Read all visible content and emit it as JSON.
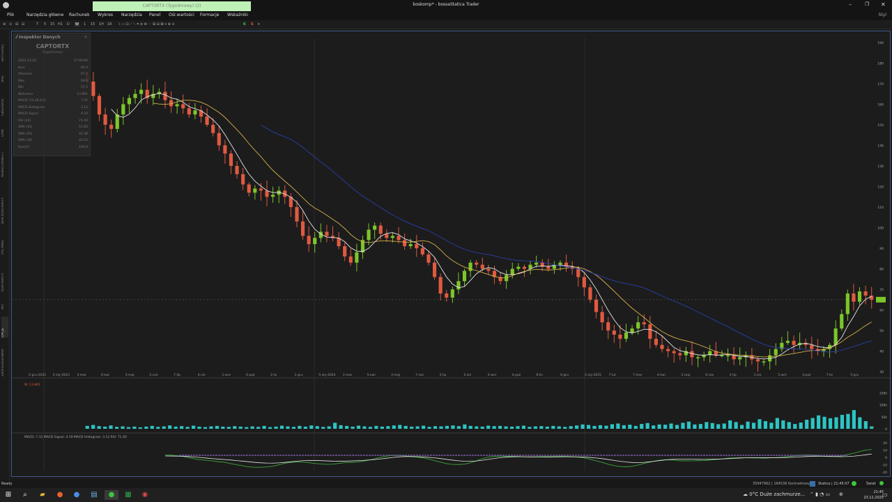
{
  "window": {
    "title": "boskomp* - bossaStatica Trader",
    "tab_label": "CAPTORTX (Tygodniowy) (2)",
    "min_icon": "minimize-icon",
    "max_icon": "maximize-icon",
    "close_icon": "close-icon"
  },
  "menu": [
    "Plik",
    "Narzędzia główne",
    "Rachunek",
    "Wykres",
    "Narzędzia",
    "Panel",
    "Ośr.wartości",
    "Formacje",
    "Wskaźniki"
  ],
  "menu_right": "Styl",
  "toolbar": {
    "intervals": [
      "T",
      "5",
      "15",
      "H1",
      "D",
      "W",
      "1",
      "15",
      "1H",
      "1R"
    ],
    "letters": [
      "K",
      "S"
    ]
  },
  "left_rail": [
    "BATTERIES",
    "BHS",
    "OBSERVOS",
    "OPW",
    "NEWSCONNECT",
    "BHR KONTRAKTY",
    "TYG MWS",
    "KONTRAKTY",
    "AKT",
    "OPCJE",
    "ZAINTERESOWANIA"
  ],
  "inspector": {
    "title": "Inspektor Danych",
    "symbol": "CAPTORTX",
    "period": "(Tygodniowy)",
    "rows": [
      {
        "k": "2025-12-22",
        "v": "17:40:00"
      },
      {
        "k": "Kurs",
        "v": "65.0"
      },
      {
        "k": "Otwarcie",
        "v": "67.2"
      },
      {
        "k": "Max",
        "v": "69.0"
      },
      {
        "k": "Min",
        "v": "57.2"
      },
      {
        "k": "Wolumen",
        "v": "13 861"
      },
      {
        "k": "MACD (12,26,9,2)",
        "v": "7.31"
      },
      {
        "k": "MACD Histogram",
        "v": "3.12"
      },
      {
        "k": "MACD Signal",
        "v": "4.19"
      },
      {
        "k": "RSI (14)",
        "v": "71.40"
      },
      {
        "k": "SMA (15)",
        "v": "51.83"
      },
      {
        "k": "SMA (45)",
        "v": "42.38"
      },
      {
        "k": "SMA (30)",
        "v": "44.53"
      },
      {
        "k": "Kurs(Y)",
        "v": "100.0"
      }
    ]
  },
  "price_axis": [
    "190",
    "180",
    "170",
    "160",
    "150",
    "140",
    "130",
    "120",
    "110",
    "100",
    "90",
    "80",
    "70",
    "60",
    "50",
    "40",
    "30"
  ],
  "date_axis": [
    "2-gru-2022",
    "5-sty-2023",
    "3-mar",
    "6-kwi",
    "5-maj",
    "2-cze",
    "7-lip",
    "4-sie",
    "1-wrz",
    "6-paź",
    "3-lis",
    "1-gru",
    "5-sty-2024",
    "1-mar",
    "5-kwi",
    "2-maj",
    "7-cze",
    "5-lip",
    "2-sie",
    "6-wrz",
    "4-paź",
    "8-lis",
    "6-gru",
    "3-sty-2025",
    "7-lut",
    "7-mar",
    "4-kwi",
    "2-maj",
    "6-cze",
    "4-lip",
    "1-sie",
    "5-wrz",
    "3-paź",
    "7-lis",
    "5-gru"
  ],
  "volume_panel": {
    "label": "W: 13 861",
    "axis": [
      "150k",
      "100k",
      "50k",
      "0"
    ]
  },
  "macd_panel": {
    "label": "MACD: 7.31  MACD Signal: 4.19  MACD Histogram: 3.12  RSI: 71.40",
    "axis": [
      "20",
      "10",
      "0",
      "-10",
      "-20"
    ]
  },
  "status": {
    "left": "Ready",
    "right": "35947962 | 164536 Kontraktowy",
    "session": "Statica | 21:45:07",
    "light": "Świat"
  },
  "taskbar": {
    "weather": "0°C  Duże zachmurze...",
    "time": "21:45",
    "date": "23.12.2025",
    "icons": [
      "windows-start-icon",
      "search-icon",
      "file-explorer-icon",
      "firefox-icon",
      "chrome-icon",
      "notes-icon",
      "trader-app-icon",
      "excel-icon",
      "camera-icon"
    ]
  },
  "colors": {
    "up": "#7cc62a",
    "down": "#e05a40",
    "volume": "#2ec4c4",
    "sma_white": "#e6e6e6",
    "sma_yellow": "#d8b04a",
    "sma_blue": "#2b3fa8",
    "macd": "#e6e6e6",
    "macd_signal": "#3aa83a",
    "macd_hist": "#7a5aa8"
  },
  "chart_data": {
    "type": "candlestick",
    "ylim": [
      28,
      192
    ],
    "x": [
      "2022-12-02",
      "2022-12-09",
      "2022-12-16",
      "2022-12-23",
      "2022-12-30",
      "2023-01-06",
      "2023-01-13",
      "2023-01-20",
      "2023-01-27",
      "2023-02-03",
      "2023-02-10",
      "2023-02-17",
      "2023-02-24",
      "2023-03-03",
      "2023-03-10",
      "2023-03-17",
      "2023-03-24",
      "2023-03-31",
      "2023-04-07",
      "2023-04-14",
      "2023-04-21",
      "2023-04-28",
      "2023-05-05",
      "2023-05-12",
      "2023-05-19",
      "2023-05-26",
      "2023-06-02",
      "2023-06-09",
      "2023-06-16",
      "2023-06-23",
      "2023-06-30",
      "2023-07-07",
      "2023-07-14",
      "2023-07-21",
      "2023-07-28",
      "2023-08-04",
      "2023-08-11",
      "2023-08-18",
      "2023-08-25",
      "2023-09-01",
      "2023-09-08",
      "2023-09-15",
      "2023-09-22",
      "2023-09-29",
      "2023-10-06",
      "2023-10-13",
      "2023-10-20",
      "2023-10-27",
      "2023-11-03",
      "2023-11-10",
      "2023-11-17",
      "2023-11-24",
      "2023-12-01",
      "2023-12-08",
      "2023-12-15",
      "2023-12-22",
      "2023-12-29",
      "2024-01-05",
      "2024-01-12",
      "2024-01-19",
      "2024-01-26",
      "2024-02-02",
      "2024-02-09",
      "2024-02-16",
      "2024-02-23",
      "2024-03-01",
      "2024-03-08",
      "2024-03-15",
      "2024-03-22",
      "2024-03-29",
      "2024-04-05",
      "2024-04-12",
      "2024-04-19",
      "2024-04-26",
      "2024-05-03",
      "2024-05-10",
      "2024-05-17",
      "2024-05-24",
      "2024-05-31",
      "2024-06-07",
      "2024-06-14",
      "2024-06-21",
      "2024-06-28",
      "2024-07-05",
      "2024-07-12",
      "2024-07-19",
      "2024-07-26",
      "2024-08-02",
      "2024-08-09",
      "2024-08-16",
      "2024-08-23",
      "2024-08-30",
      "2024-09-06",
      "2024-09-13",
      "2024-09-20",
      "2024-09-27",
      "2024-10-04",
      "2024-10-11",
      "2024-10-18",
      "2024-10-25",
      "2024-11-01",
      "2024-11-08",
      "2024-11-15",
      "2024-11-22",
      "2024-11-29",
      "2024-12-06",
      "2024-12-13",
      "2024-12-20",
      "2024-12-27",
      "2025-01-03",
      "2025-01-10",
      "2025-01-17",
      "2025-01-24",
      "2025-01-31",
      "2025-02-07",
      "2025-02-14",
      "2025-02-21",
      "2025-02-28",
      "2025-03-07",
      "2025-03-14",
      "2025-03-21",
      "2025-03-28",
      "2025-04-04",
      "2025-04-11",
      "2025-04-18",
      "2025-04-25",
      "2025-05-02",
      "2025-05-09",
      "2025-05-16",
      "2025-05-23",
      "2025-05-30",
      "2025-06-06",
      "2025-06-13",
      "2025-06-20",
      "2025-06-27",
      "2025-07-04",
      "2025-07-11",
      "2025-07-18",
      "2025-07-25",
      "2025-08-01",
      "2025-08-08",
      "2025-08-15",
      "2025-08-22",
      "2025-08-29",
      "2025-09-05",
      "2025-09-12",
      "2025-09-19",
      "2025-09-26",
      "2025-10-03",
      "2025-10-10",
      "2025-10-17",
      "2025-10-24",
      "2025-10-31",
      "2025-11-07",
      "2025-11-14",
      "2025-11-21",
      "2025-11-28",
      "2025-12-05",
      "2025-12-12",
      "2025-12-19",
      "2025-12-22"
    ],
    "close": [
      171,
      164,
      155,
      150,
      148,
      155,
      160,
      163,
      165,
      167,
      163,
      165,
      166,
      162,
      159,
      160,
      158,
      155,
      157,
      154,
      150,
      146,
      140,
      136,
      130,
      126,
      121,
      117,
      119,
      118,
      115,
      116,
      118,
      115,
      110,
      103,
      96,
      92,
      95,
      98,
      96,
      95,
      91,
      86,
      83,
      88,
      94,
      99,
      101,
      97,
      95,
      96,
      94,
      91,
      92,
      90,
      87,
      83,
      76,
      68,
      66,
      70,
      74,
      79,
      83,
      82,
      80,
      79,
      76,
      74,
      77,
      80,
      81,
      80,
      82,
      83,
      81,
      80,
      82,
      83,
      81,
      80,
      76,
      71,
      65,
      59,
      54,
      50,
      48,
      46,
      49,
      51,
      54,
      53,
      46,
      43,
      41,
      40,
      39,
      38,
      40,
      37,
      37,
      38,
      40,
      38,
      38,
      38,
      36,
      37,
      38,
      36,
      35,
      35,
      38,
      41,
      44,
      45,
      43,
      44,
      43,
      41,
      40,
      41,
      43,
      51,
      58,
      68,
      64,
      69,
      67,
      65
    ],
    "volume_k": [
      12,
      16,
      11,
      9,
      14,
      8,
      10,
      7,
      9,
      6,
      9,
      12,
      8,
      10,
      14,
      9,
      11,
      8,
      13,
      9,
      7,
      10,
      12,
      9,
      8,
      11,
      9,
      7,
      10,
      8,
      12,
      7,
      9,
      13,
      10,
      8,
      12,
      9,
      14,
      11,
      8,
      10,
      25,
      15,
      12,
      9,
      13,
      10,
      8,
      12,
      9,
      11,
      14,
      16,
      12,
      9,
      10,
      13,
      8,
      11,
      10,
      12,
      14,
      11,
      18,
      12,
      10,
      9,
      13,
      11,
      12,
      10,
      9,
      11,
      13,
      8,
      10,
      11,
      9,
      12,
      10,
      8,
      11,
      14,
      18,
      16,
      12,
      15,
      13,
      19,
      22,
      15,
      17,
      12,
      20,
      24,
      14,
      18,
      17,
      22,
      16,
      25,
      30,
      18,
      20,
      28,
      24,
      19,
      22,
      35,
      28,
      16,
      30,
      25,
      40,
      32,
      25,
      45,
      35,
      28,
      20,
      26,
      38,
      45,
      56,
      50,
      44,
      48,
      58,
      62,
      78,
      48,
      32,
      10
    ],
    "sma_15": [
      null,
      null,
      null,
      null,
      null,
      null,
      null,
      null,
      null,
      null,
      null,
      null,
      null,
      null,
      null,
      null,
      null,
      null,
      null,
      null,
      null,
      null,
      null,
      null,
      null,
      null,
      null,
      null,
      null,
      null,
      null,
      null,
      null,
      null,
      null,
      null,
      null,
      null,
      null,
      null,
      null,
      null,
      null,
      null,
      null,
      null,
      null,
      null,
      null,
      null,
      null,
      null,
      null,
      null,
      null,
      null,
      null,
      null,
      null,
      null,
      null,
      null,
      null,
      null,
      null,
      null,
      null,
      null,
      null,
      null,
      null,
      null,
      null,
      null,
      null,
      null,
      null,
      null,
      null,
      null,
      null,
      null,
      null,
      null,
      null,
      null,
      null,
      null,
      null,
      null,
      null,
      null,
      null,
      null,
      null,
      null,
      null,
      null,
      null,
      null,
      null,
      null,
      null,
      null,
      null,
      null,
      null,
      null,
      null,
      null,
      null,
      null,
      null,
      null,
      null,
      null,
      null,
      null,
      null,
      null,
      null,
      null,
      null,
      null,
      null,
      null,
      null,
      null,
      null,
      null,
      null,
      null
    ],
    "series_names": [
      "SMA (15)",
      "SMA (45)",
      "SMA (30)"
    ]
  }
}
